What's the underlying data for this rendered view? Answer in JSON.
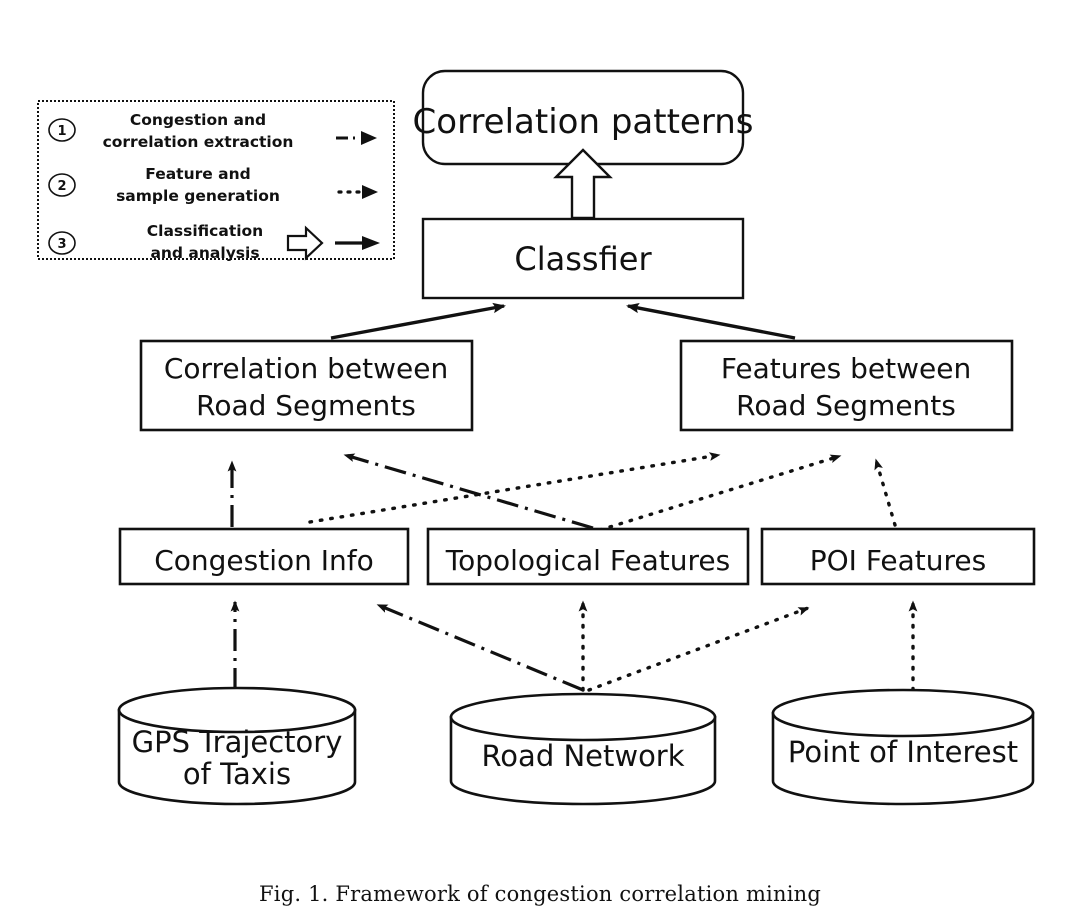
{
  "figure": {
    "caption": "Fig. 1.  Framework of congestion correlation mining"
  },
  "legend": {
    "items": [
      {
        "number": "1",
        "line1": "Congestion and",
        "line2": "correlation  extraction",
        "arrow_style": "dash-dot"
      },
      {
        "number": "2",
        "line1": "Feature and",
        "line2": "sample generation",
        "arrow_style": "dotted"
      },
      {
        "number": "3",
        "line1": "Classification",
        "line2": "and analysis",
        "arrow_style": "solid-block"
      }
    ]
  },
  "nodes": {
    "output": {
      "label": "Correlation patterns",
      "shape": "rounded-rectangle"
    },
    "classifier": {
      "label": "Classfier",
      "shape": "rectangle"
    },
    "correlation_between": {
      "line1": "Correlation between",
      "line2": "Road Segments",
      "shape": "rectangle"
    },
    "features_between": {
      "line1": "Features between",
      "line2": "Road Segments",
      "shape": "rectangle"
    },
    "congestion_info": {
      "label": "Congestion Info",
      "shape": "rectangle"
    },
    "topological_features": {
      "label": "Topological Features",
      "shape": "rectangle"
    },
    "poi_features": {
      "label": "POI Features",
      "shape": "rectangle"
    },
    "gps_trajectory": {
      "line1": "GPS Trajectory",
      "line2": "of Taxis",
      "shape": "cylinder"
    },
    "road_network": {
      "label": "Road Network",
      "shape": "cylinder"
    },
    "point_of_interest": {
      "label": "Point of Interest",
      "shape": "cylinder"
    }
  },
  "colors": {
    "stroke": "#111111",
    "fill": "#ffffff",
    "legend_border": "#888888",
    "background": "#ffffff"
  }
}
